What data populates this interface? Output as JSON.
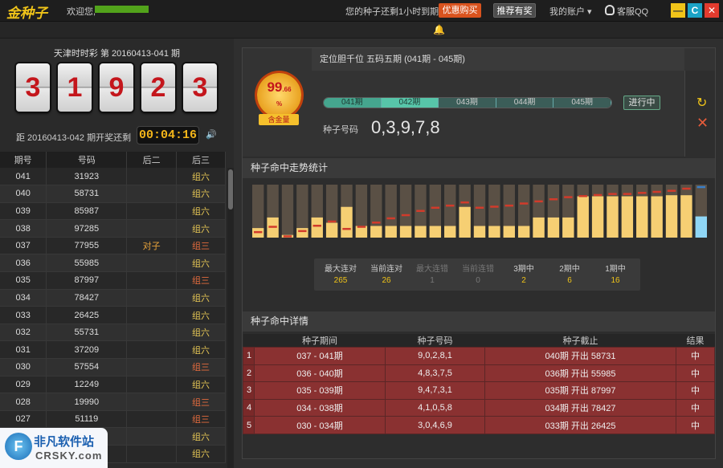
{
  "topbar": {
    "logo": "金种子",
    "welcome": "欢迎您,",
    "notice": "您的种子还剩1小时到期",
    "buy_button": "优惠购买",
    "recommend_button": "推荐有奖",
    "account_menu": "我的账户 ▾",
    "service_qq": "客服QQ",
    "colors": {
      "buy": "#d9531e",
      "minimize": "#f0c419",
      "refresh": "#1ba3c6",
      "close": "#e23b2e"
    }
  },
  "draw": {
    "title": "天津时时彩 第 20160413-041 期",
    "digits": [
      "3",
      "1",
      "9",
      "2",
      "3"
    ],
    "next_text": "距 20160413-042 期开奖还剩",
    "countdown": "00:04:16",
    "columns": [
      "期号",
      "号码",
      "后二",
      "后三"
    ],
    "rows": [
      [
        "041",
        "31923",
        "",
        "组六"
      ],
      [
        "040",
        "58731",
        "",
        "组六"
      ],
      [
        "039",
        "85987",
        "",
        "组六"
      ],
      [
        "038",
        "97285",
        "",
        "组六"
      ],
      [
        "037",
        "77955",
        "对子",
        "组三"
      ],
      [
        "036",
        "55985",
        "",
        "组六"
      ],
      [
        "035",
        "87997",
        "",
        "组三"
      ],
      [
        "034",
        "78427",
        "",
        "组六"
      ],
      [
        "033",
        "26425",
        "",
        "组六"
      ],
      [
        "032",
        "55731",
        "",
        "组六"
      ],
      [
        "031",
        "37209",
        "",
        "组六"
      ],
      [
        "030",
        "57554",
        "",
        "组三"
      ],
      [
        "029",
        "12249",
        "",
        "组六"
      ],
      [
        "028",
        "19990",
        "",
        "组三"
      ],
      [
        "027",
        "51119",
        "",
        "组三"
      ],
      [
        "026",
        "03576",
        "",
        "组六"
      ],
      [
        "025",
        "18023",
        "",
        "组六"
      ]
    ]
  },
  "seed": {
    "medal_value": "99",
    "medal_decimal": ".66",
    "medal_percent": "%",
    "medal_label": "含金量",
    "title": "定位胆千位 五码五期 (041期 - 045期)",
    "periods": [
      "041期",
      "042期",
      "043期",
      "044期",
      "045期"
    ],
    "done_count": 1,
    "active_index": 1,
    "progress_button": "进行中",
    "number_label": "种子号码",
    "numbers": "0,3,9,7,8"
  },
  "trend": {
    "title": "种子命中走势统计",
    "stats": [
      {
        "label": "最大连对",
        "value": "265",
        "dim": false
      },
      {
        "label": "当前连对",
        "value": "26",
        "dim": false
      },
      {
        "label": "最大连错",
        "value": "1",
        "dim": true
      },
      {
        "label": "当前连错",
        "value": "0",
        "dim": true
      },
      {
        "label": "3期中",
        "value": "2",
        "dim": false
      },
      {
        "label": "2期中",
        "value": "6",
        "dim": false
      },
      {
        "label": "1期中",
        "value": "16",
        "dim": false
      }
    ]
  },
  "chart_data": {
    "type": "bar",
    "bars": [
      0.18,
      0.38,
      0.05,
      0.18,
      0.38,
      0.28,
      0.58,
      0.22,
      0.22,
      0.22,
      0.22,
      0.22,
      0.22,
      0.22,
      0.58,
      0.22,
      0.22,
      0.22,
      0.22,
      0.38,
      0.38,
      0.38,
      0.78,
      0.78,
      0.78,
      0.78,
      0.78,
      0.78,
      0.8,
      0.8,
      0.4
    ],
    "markers": [
      0.1,
      0.2,
      0.02,
      0.12,
      0.22,
      0.3,
      0.16,
      0.2,
      0.28,
      0.36,
      0.42,
      0.5,
      0.56,
      0.6,
      0.66,
      0.56,
      0.58,
      0.6,
      0.64,
      0.68,
      0.72,
      0.76,
      0.78,
      0.8,
      0.82,
      0.82,
      0.84,
      0.86,
      0.88,
      0.92,
      0.95
    ],
    "colors": {
      "bar": "#f6cf73",
      "track": "#5a5045",
      "marker": "#d13b2b",
      "last_bar": "#8fd6f5",
      "last_marker": "#3a7fc8"
    }
  },
  "details": {
    "title": "种子命中详情",
    "columns": [
      "种子期间",
      "种子号码",
      "种子截止",
      "结果"
    ],
    "rows": [
      {
        "idx": "1",
        "period": "037 - 041期",
        "numbers": "9,0,2,8,1",
        "end": "040期 开出 58731",
        "result": "中"
      },
      {
        "idx": "2",
        "period": "036 - 040期",
        "numbers": "4,8,3,7,5",
        "end": "036期 开出 55985",
        "result": "中"
      },
      {
        "idx": "3",
        "period": "035 - 039期",
        "numbers": "9,4,7,3,1",
        "end": "035期 开出 87997",
        "result": "中"
      },
      {
        "idx": "4",
        "period": "034 - 038期",
        "numbers": "4,1,0,5,8",
        "end": "034期 开出 78427",
        "result": "中"
      },
      {
        "idx": "5",
        "period": "030 - 034期",
        "numbers": "3,0,4,6,9",
        "end": "033期 开出 26425",
        "result": "中"
      }
    ]
  },
  "watermark": {
    "badge": "F",
    "line1": "非凡软件站",
    "line2": "CRSKY.com"
  }
}
